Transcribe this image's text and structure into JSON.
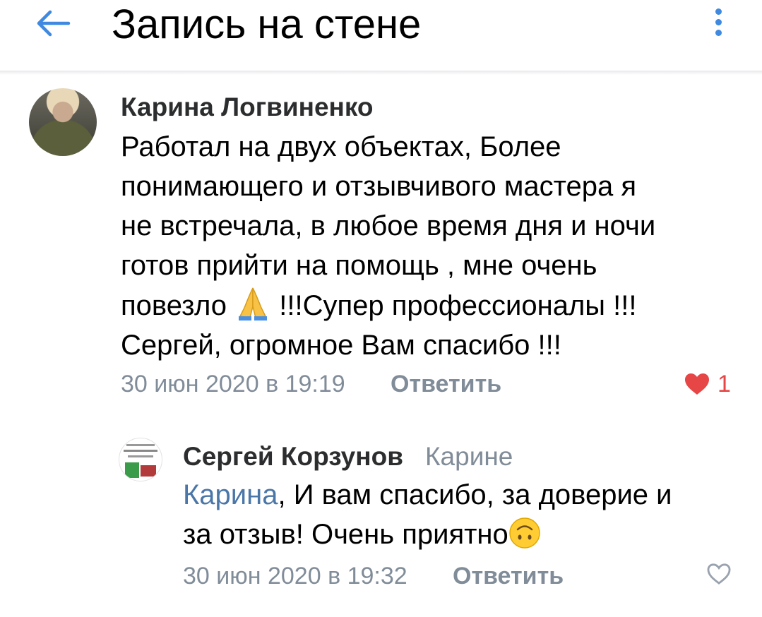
{
  "header": {
    "title": "Запись на стене",
    "back_icon": "arrow-left-icon",
    "more_icon": "more-vertical-icon",
    "accent_color": "#3f8ae0"
  },
  "comments": [
    {
      "author": "Карина Логвиненко",
      "text_lines": [
        "Работал на двух объектах, Более",
        "понимающего и отзывчивого мастера я",
        "не встречала, в любое время дня и ночи",
        "готов прийти на помощь , мне очень"
      ],
      "text_line5_before": "повезло ",
      "text_line5_after": " !!!Супер профессионалы !!!",
      "text_line6": "Сергей, огромное Вам спасибо !!!",
      "emoji": "folded-hands-emoji",
      "date": "30 июн 2020 в 19:19",
      "reply_label": "Ответить",
      "likes": "1",
      "liked": true
    },
    {
      "author": "Сергей Корзунов",
      "reply_to": "Карине",
      "mention": "Карина",
      "text_after_mention": ", И вам спасибо, за доверие и",
      "text_line2": "за отзыв! Очень приятно",
      "emoji": "upside-down-face-emoji",
      "date": "30 июн 2020 в 19:32",
      "reply_label": "Ответить",
      "liked": false
    }
  ],
  "colors": {
    "link": "#4a76a8",
    "secondary_text": "#818c99",
    "like_active": "#e64646",
    "like_inactive": "#99a2ad"
  }
}
